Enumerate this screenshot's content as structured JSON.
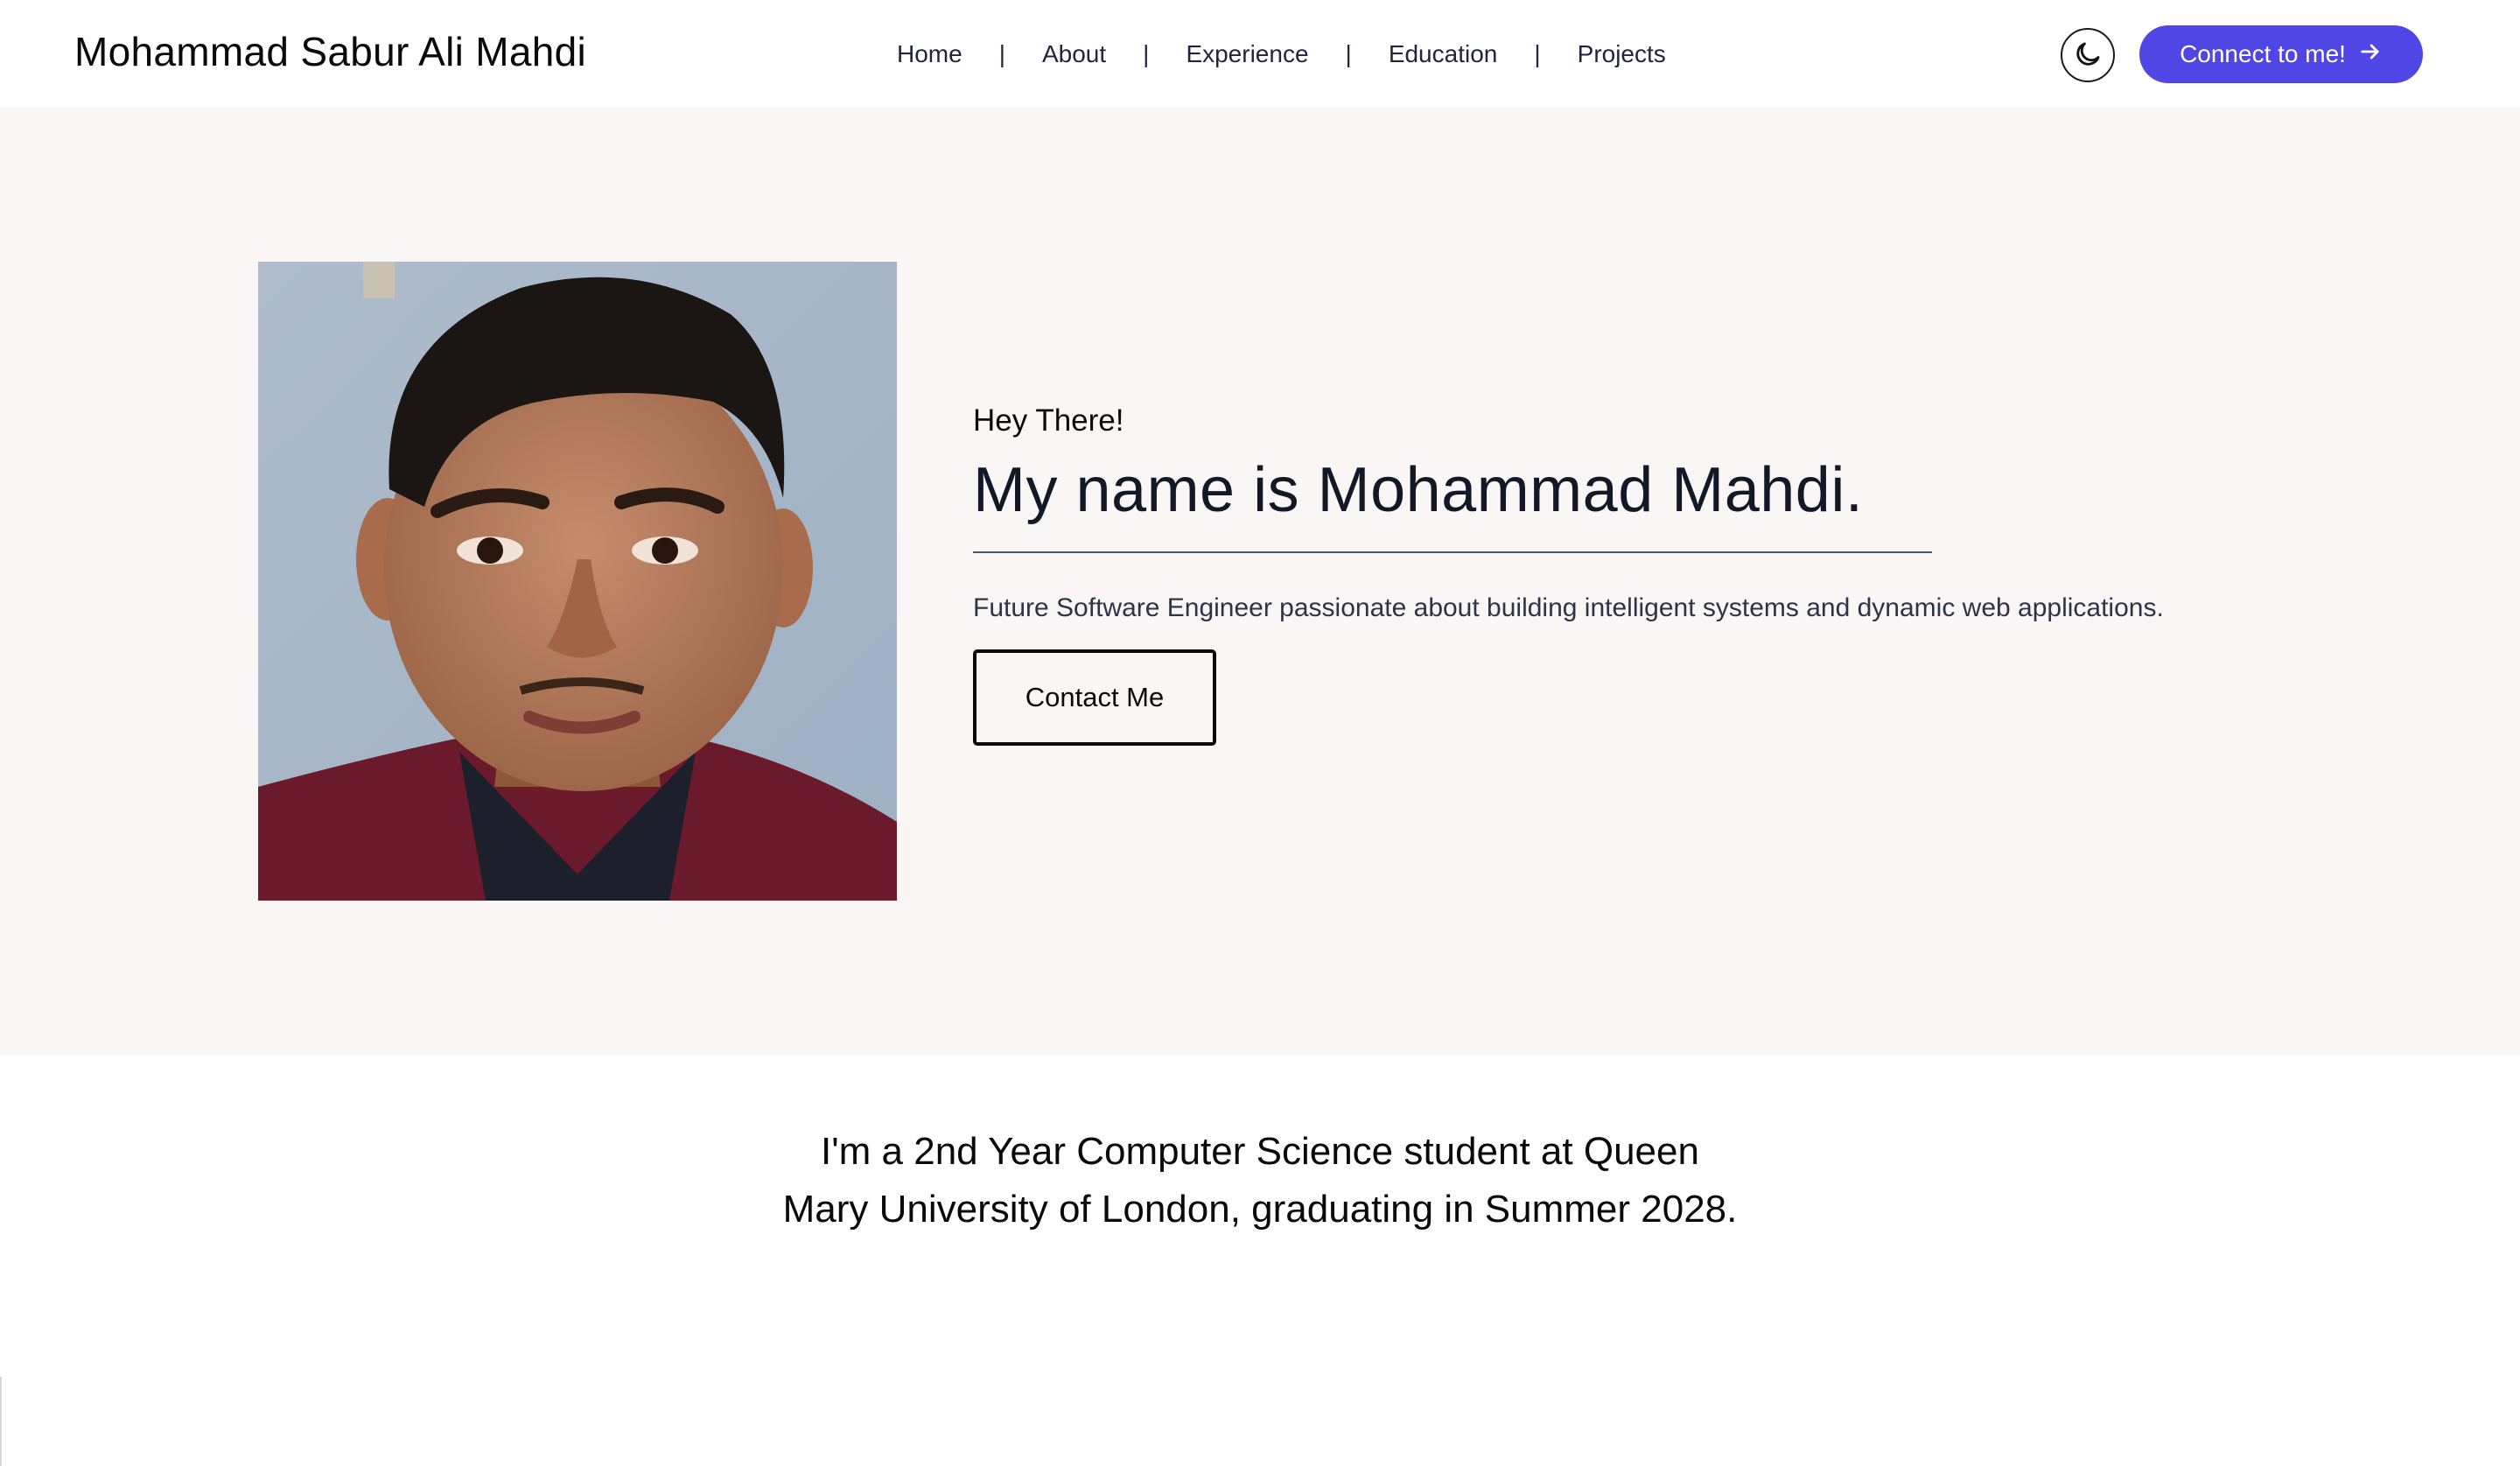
{
  "nav": {
    "brand": "Mohammad Sabur Ali Mahdi",
    "links": [
      "Home",
      "About",
      "Experience",
      "Education",
      "Projects"
    ],
    "separator": "|",
    "theme_toggle_icon": "moon-icon",
    "connect_label": "Connect to me!",
    "connect_icon": "arrow-right-icon",
    "accent_color": "#4f46e5"
  },
  "hero": {
    "greeting": "Hey There!",
    "headline": "My name is Mohammad Mahdi.",
    "tagline": "Future Software Engineer passionate about building intelligent systems and dynamic web applications.",
    "contact_label": "Contact Me",
    "background_color": "#f9f6f5"
  },
  "about": {
    "text": "I'm a 2nd Year Computer Science student at Queen Mary University of London, graduating in Summer 2028."
  }
}
